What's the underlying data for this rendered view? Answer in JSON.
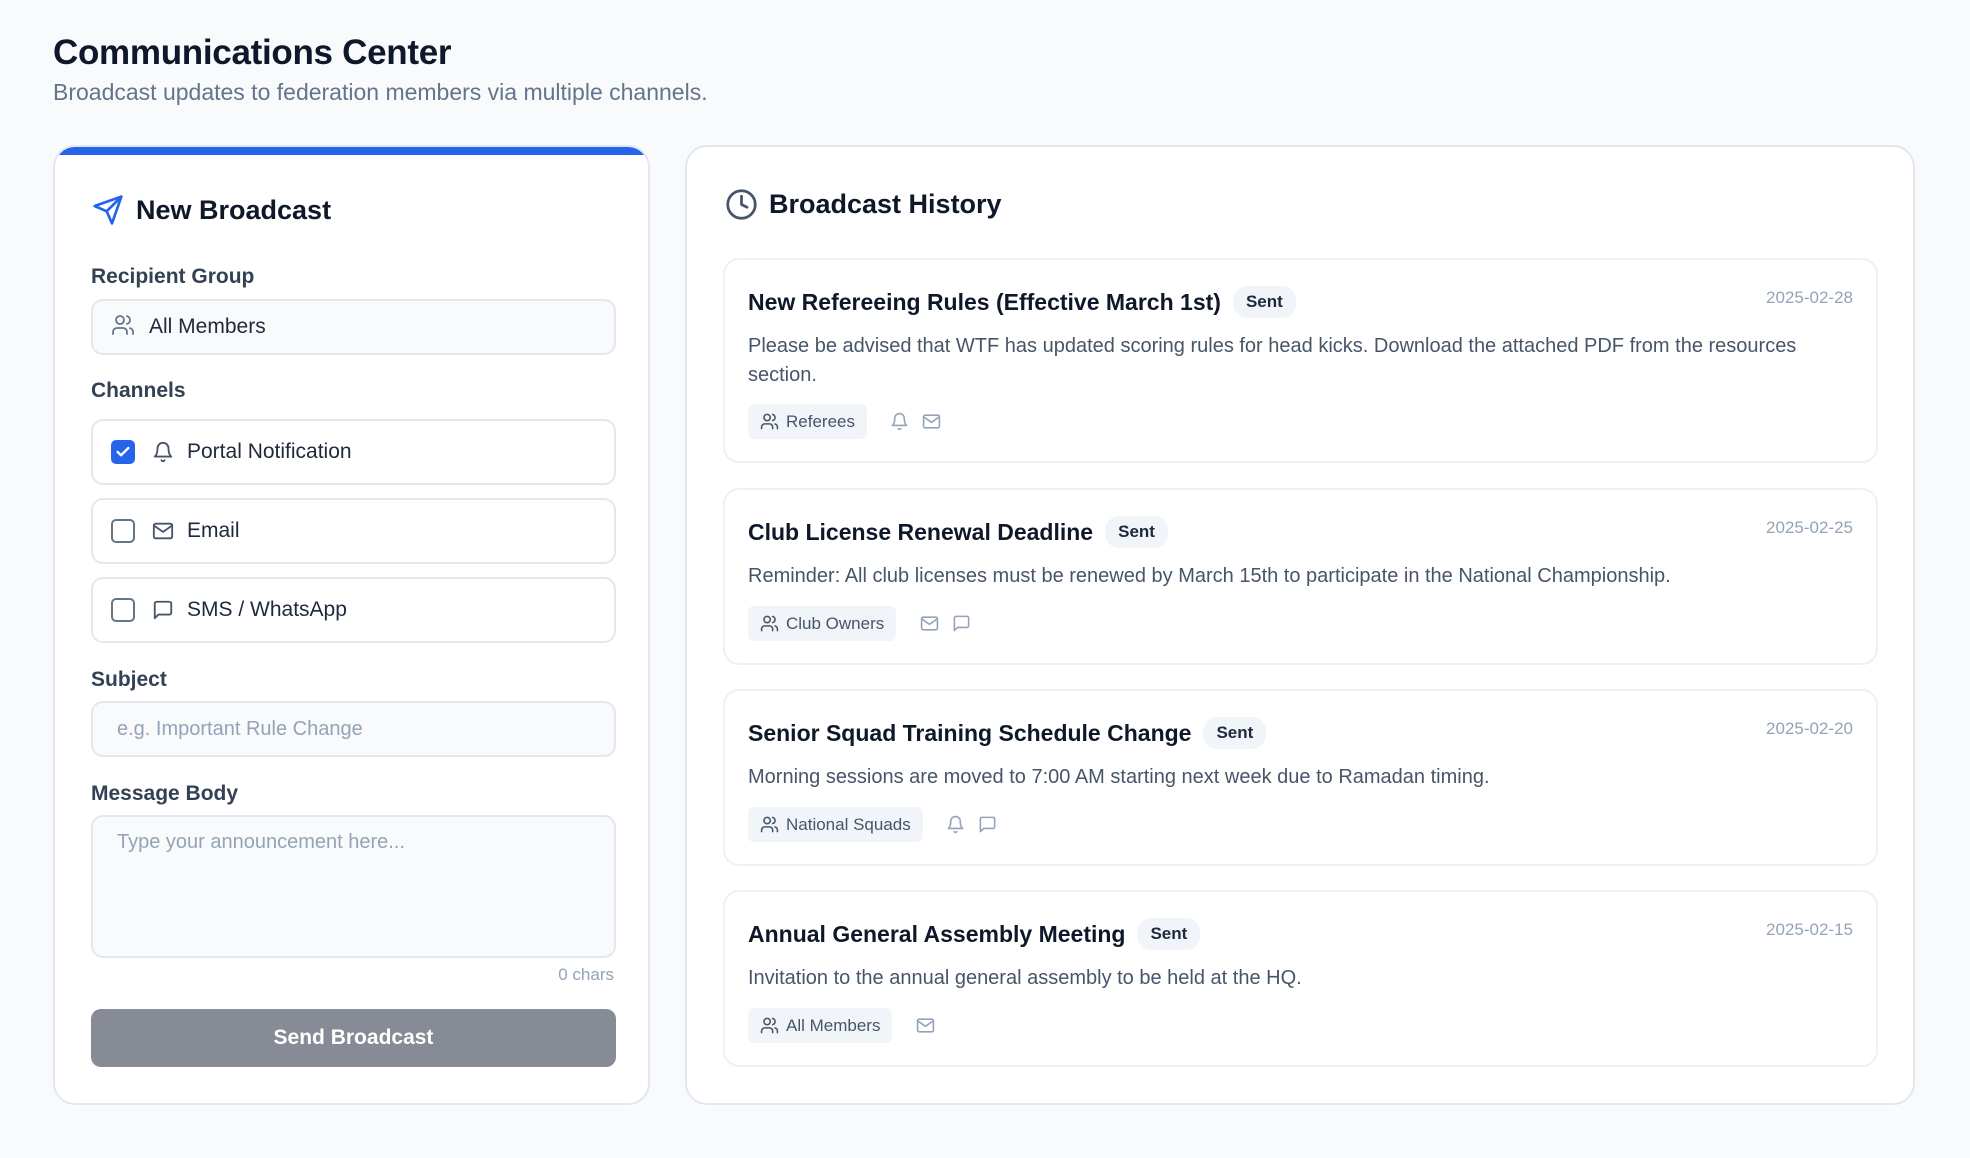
{
  "page": {
    "title": "Communications Center",
    "subtitle": "Broadcast updates to federation members via multiple channels."
  },
  "compose": {
    "title": "New Broadcast",
    "recipient_label": "Recipient Group",
    "recipient_value": "All Members",
    "channels_label": "Channels",
    "channels": [
      {
        "label": "Portal Notification",
        "checked": true,
        "icon": "bell-icon"
      },
      {
        "label": "Email",
        "checked": false,
        "icon": "mail-icon"
      },
      {
        "label": "SMS / WhatsApp",
        "checked": false,
        "icon": "chat-icon"
      }
    ],
    "subject_label": "Subject",
    "subject_placeholder": "e.g. Important Rule Change",
    "body_label": "Message Body",
    "body_placeholder": "Type your announcement here...",
    "char_count": "0 chars",
    "send_label": "Send Broadcast"
  },
  "history": {
    "title": "Broadcast History",
    "items": [
      {
        "title": "New Refereeing Rules (Effective March 1st)",
        "status": "Sent",
        "date": "2025-02-28",
        "body": "Please be advised that WTF has updated scoring rules for head kicks. Download the attached PDF from the resources section.",
        "group": "Referees",
        "channels": [
          "bell-icon",
          "mail-icon"
        ]
      },
      {
        "title": "Club License Renewal Deadline",
        "status": "Sent",
        "date": "2025-02-25",
        "body": "Reminder: All club licenses must be renewed by March 15th to participate in the National Championship.",
        "group": "Club Owners",
        "channels": [
          "mail-icon",
          "chat-icon"
        ]
      },
      {
        "title": "Senior Squad Training Schedule Change",
        "status": "Sent",
        "date": "2025-02-20",
        "body": "Morning sessions are moved to 7:00 AM starting next week due to Ramadan timing.",
        "group": "National Squads",
        "channels": [
          "bell-icon",
          "chat-icon"
        ]
      },
      {
        "title": "Annual General Assembly Meeting",
        "status": "Sent",
        "date": "2025-02-15",
        "body": "Invitation to the annual general assembly to be held at the HQ.",
        "group": "All Members",
        "channels": [
          "mail-icon"
        ]
      }
    ]
  },
  "colors": {
    "accent": "#2563eb",
    "background": "#f8fafc",
    "send_button_disabled": "#868b96"
  }
}
